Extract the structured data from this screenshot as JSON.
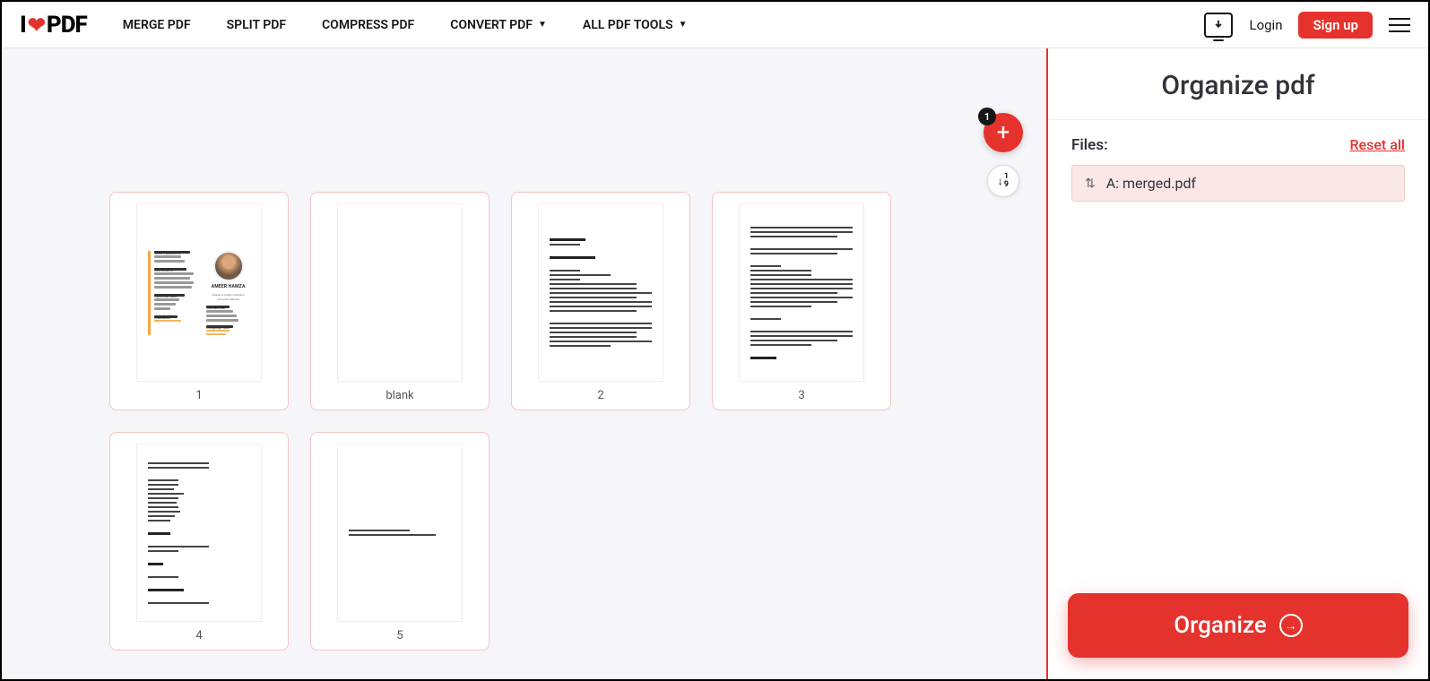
{
  "nav": {
    "merge": "MERGE PDF",
    "split": "SPLIT PDF",
    "compress": "COMPRESS PDF",
    "convert": "CONVERT PDF",
    "alltools": "ALL PDF TOOLS"
  },
  "header": {
    "login": "Login",
    "signup": "Sign up"
  },
  "fab": {
    "badge": "1"
  },
  "pages": [
    {
      "label": "1"
    },
    {
      "label": "blank"
    },
    {
      "label": "2"
    },
    {
      "label": "3"
    },
    {
      "label": "4"
    },
    {
      "label": "5"
    }
  ],
  "sidebar": {
    "title": "Organize pdf",
    "files_label": "Files:",
    "reset": "Reset all",
    "file_name": "A: merged.pdf",
    "organize": "Organize"
  },
  "thumb1": {
    "title": "AMEER HAMZA",
    "subtitle": "Freelance Graphic Designer Computer Operator",
    "s1": "Work Experience",
    "s2": "Certificates",
    "s3": "Expertise Skill",
    "s4": "Education",
    "s5": "Language Skill",
    "contact": "Contact Me"
  }
}
